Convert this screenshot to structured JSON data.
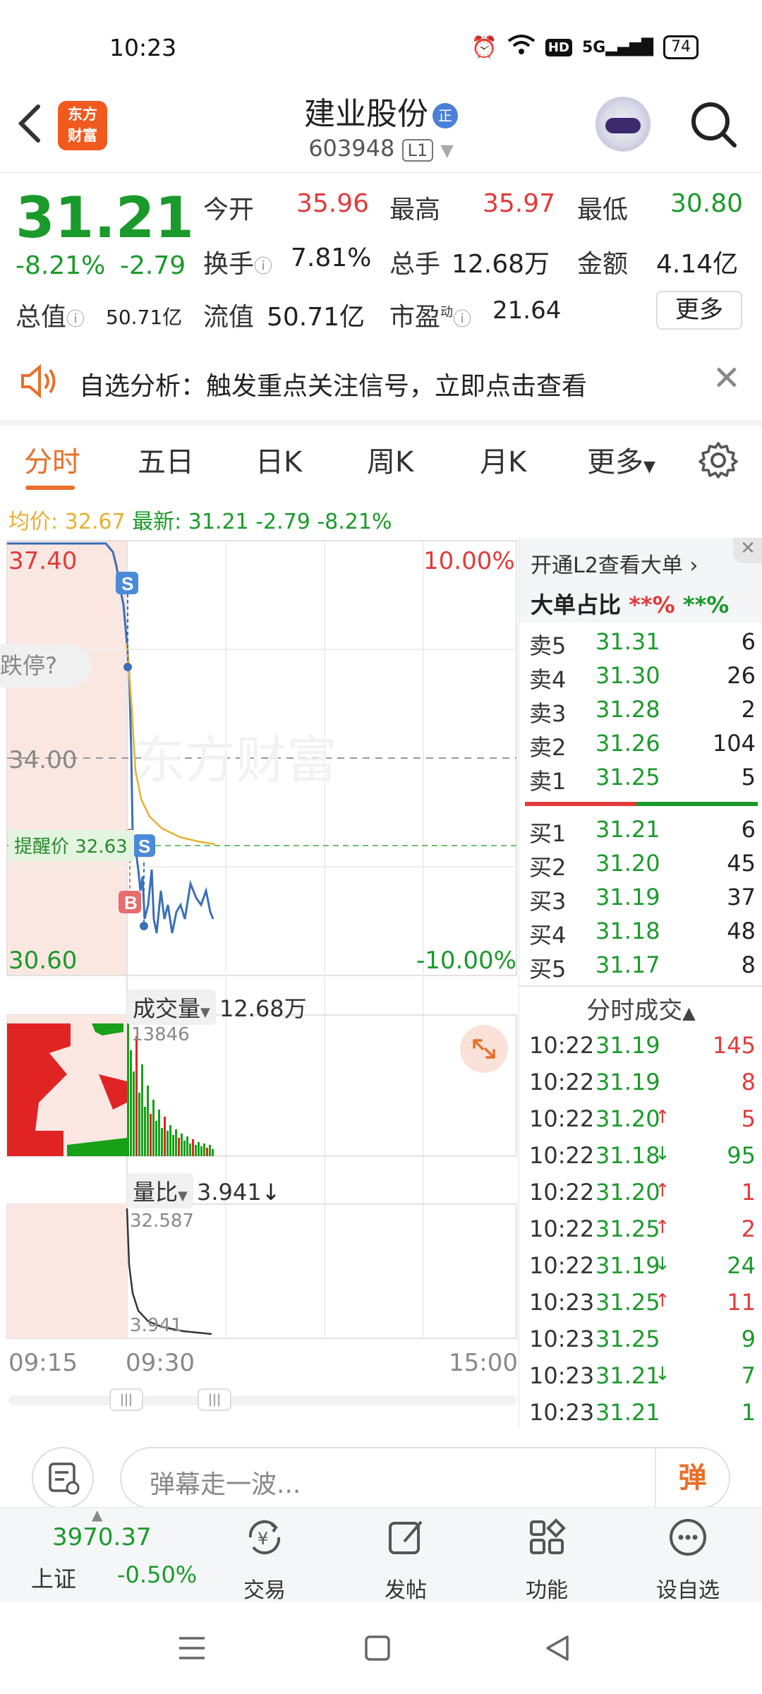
{
  "status": {
    "time": "10:23",
    "network": "5G",
    "battery": "74"
  },
  "header": {
    "stock_name": "建业股份",
    "badge": "正",
    "code": "603948",
    "level": "L1",
    "logo_line1": "东方",
    "logo_line2": "财富"
  },
  "quote": {
    "price": "31.21",
    "change_pct": "-8.21%",
    "change_amt": "-2.79",
    "open_label": "今开",
    "open": "35.96",
    "high_label": "最高",
    "high": "35.97",
    "low_label": "最低",
    "low": "30.80",
    "turnover_label": "换手",
    "turnover": "7.81%",
    "volume_label": "总手",
    "volume": "12.68万",
    "amount_label": "金额",
    "amount": "4.14亿",
    "mktcap_label": "总值",
    "mktcap": "50.71亿",
    "float_label": "流值",
    "float": "50.71亿",
    "pe_label": "市盈",
    "pe_sup": "动",
    "pe": "21.64",
    "more": "更多"
  },
  "notice": {
    "text": "自选分析：触发重点关注信号，立即点击查看"
  },
  "tabs": [
    {
      "label": "分时"
    },
    {
      "label": "五日"
    },
    {
      "label": "日K"
    },
    {
      "label": "周K"
    },
    {
      "label": "月K"
    },
    {
      "label": "更多"
    }
  ],
  "avgline": {
    "avg_label": "均价:",
    "avg": "32.67",
    "latest_label": "最新:",
    "latest": "31.21",
    "chg": "-2.79",
    "pct": "-8.21%"
  },
  "chart": {
    "top_price": "37.40",
    "mid_price": "34.00",
    "bottom_price": "30.60",
    "top_pct": "10.00%",
    "bottom_pct": "-10.00%",
    "limit_bubble": "跌停?",
    "alert_label": "提醒价 32.63",
    "watermark": "东方财富",
    "volume_label": "成交量",
    "volume_value": "12.68万",
    "volume_peak": "13846",
    "ratio_label": "量比",
    "ratio_value": "3.941",
    "ratio_peak": "32.587",
    "ratio_low": "3.941",
    "time_start": "09:15",
    "time_open": "09:30",
    "time_end": "15:00"
  },
  "orderbook": {
    "promo": "开通L2查看大单",
    "big_label": "大单占比",
    "big_red": "**%",
    "big_green": "**%",
    "asks": [
      {
        "label": "卖5",
        "price": "31.31",
        "vol": "6"
      },
      {
        "label": "卖4",
        "price": "31.30",
        "vol": "26"
      },
      {
        "label": "卖3",
        "price": "31.28",
        "vol": "2"
      },
      {
        "label": "卖2",
        "price": "31.26",
        "vol": "104"
      },
      {
        "label": "卖1",
        "price": "31.25",
        "vol": "5"
      }
    ],
    "bids": [
      {
        "label": "买1",
        "price": "31.21",
        "vol": "6"
      },
      {
        "label": "买2",
        "price": "31.20",
        "vol": "45"
      },
      {
        "label": "买3",
        "price": "31.19",
        "vol": "37"
      },
      {
        "label": "买4",
        "price": "31.18",
        "vol": "48"
      },
      {
        "label": "买5",
        "price": "31.17",
        "vol": "8"
      }
    ],
    "trades_title": "分时成交",
    "trades": [
      {
        "time": "10:22",
        "price": "31.19",
        "arrow": "",
        "vol": "145",
        "vcolor": "red"
      },
      {
        "time": "10:22",
        "price": "31.19",
        "arrow": "",
        "vol": "8",
        "vcolor": "red"
      },
      {
        "time": "10:22",
        "price": "31.20",
        "arrow": "↑",
        "vol": "5",
        "vcolor": "red"
      },
      {
        "time": "10:22",
        "price": "31.18",
        "arrow": "↓",
        "vol": "95",
        "vcolor": "green"
      },
      {
        "time": "10:22",
        "price": "31.20",
        "arrow": "↑",
        "vol": "1",
        "vcolor": "red"
      },
      {
        "time": "10:22",
        "price": "31.25",
        "arrow": "↑",
        "vol": "2",
        "vcolor": "red"
      },
      {
        "time": "10:22",
        "price": "31.19",
        "arrow": "↓",
        "vol": "24",
        "vcolor": "green"
      },
      {
        "time": "10:23",
        "price": "31.25",
        "arrow": "↑",
        "vol": "11",
        "vcolor": "red"
      },
      {
        "time": "10:23",
        "price": "31.25",
        "arrow": "",
        "vol": "9",
        "vcolor": "green"
      },
      {
        "time": "10:23",
        "price": "31.21",
        "arrow": "↓",
        "vol": "7",
        "vcolor": "green"
      },
      {
        "time": "10:23",
        "price": "31.21",
        "arrow": "",
        "vol": "1",
        "vcolor": "green"
      }
    ]
  },
  "comment": {
    "placeholder": "弹幕走一波...",
    "dan": "弹"
  },
  "bottomnav": {
    "index_value": "3970.37",
    "index_name": "上证",
    "index_pct": "-0.50%",
    "items": [
      {
        "label": "交易"
      },
      {
        "label": "发帖"
      },
      {
        "label": "功能"
      },
      {
        "label": "设自选"
      }
    ]
  },
  "colors": {
    "up": "#e23a3a",
    "down": "#1a9a2a",
    "accent": "#e8702a",
    "avg": "#e8b030",
    "line": "#3b6fb8"
  }
}
